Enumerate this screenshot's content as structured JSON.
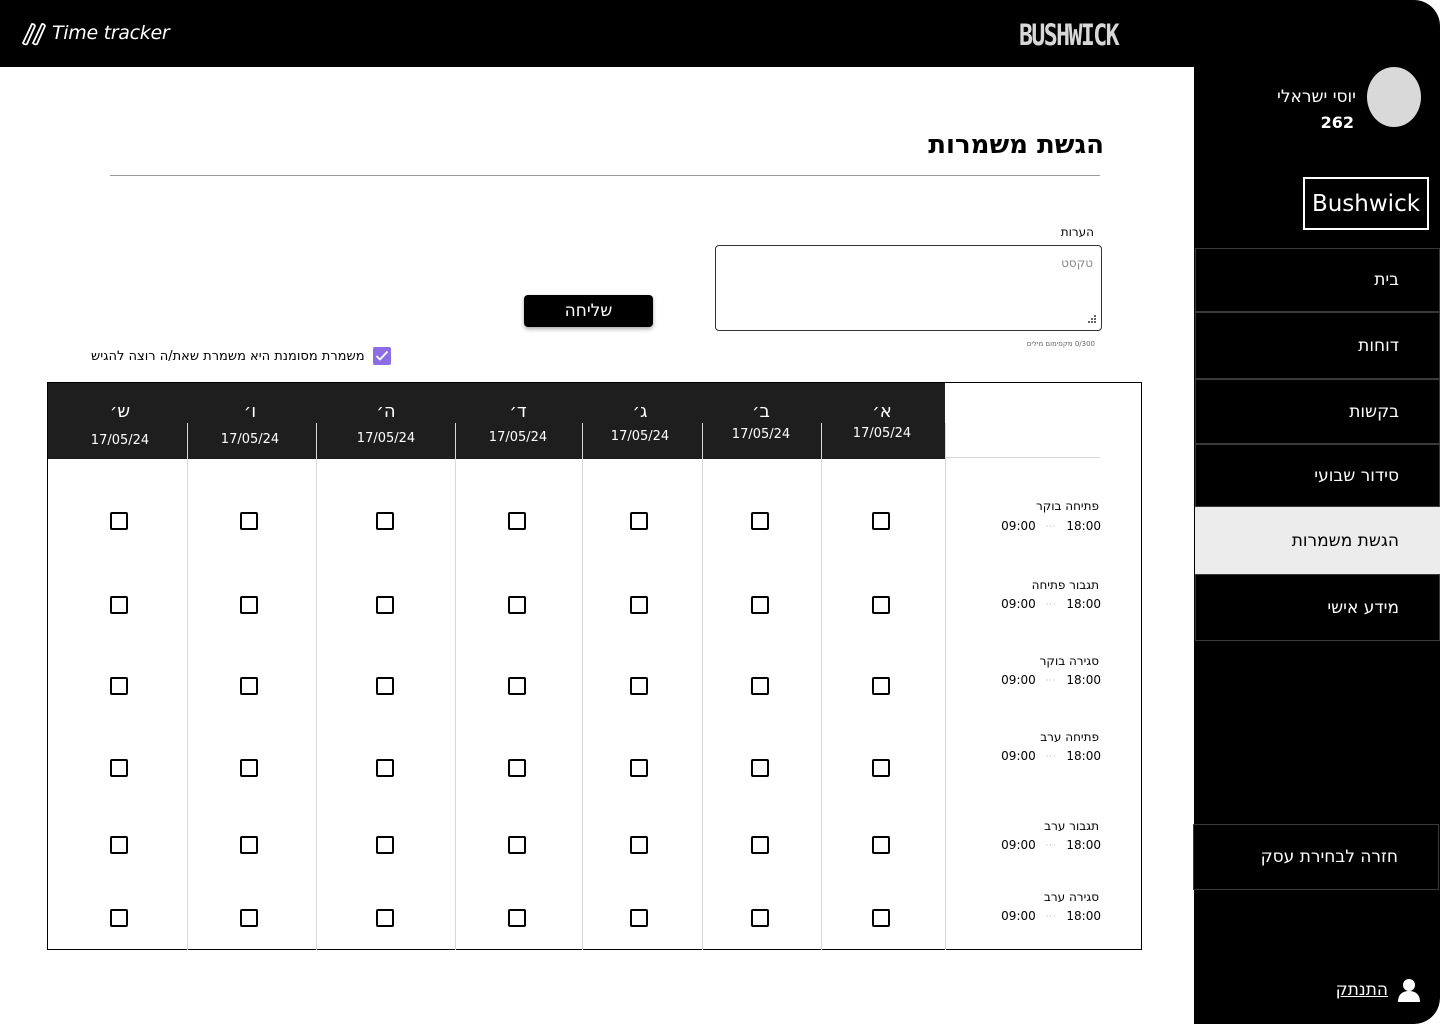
{
  "app": {
    "logo_text": "Time tracker",
    "brand": "BUSHWICK"
  },
  "user": {
    "name": "יוסי ישראלי",
    "id": "262"
  },
  "sidebar": {
    "business": "Bushwick",
    "items": [
      {
        "label": "בית",
        "active": false
      },
      {
        "label": "דוחות",
        "active": false
      },
      {
        "label": "בקשות",
        "active": false
      },
      {
        "label": "סידור שבועי",
        "active": false
      },
      {
        "label": "הגשת משמרות",
        "active": true
      },
      {
        "label": "מידע אישי",
        "active": false
      }
    ],
    "back_label": "חזרה לבחירת עסק",
    "logout_label": "התנתק"
  },
  "page": {
    "title": "הגשת משמרות",
    "notes_label": "הערות",
    "notes_placeholder": "טקסט",
    "notes_value": "",
    "char_count": "0/300 מקסימום מילים",
    "send_label": "שליחה",
    "legend_text": "משמרת מסומנת היא משמרת שאת/ה רוצה להגיש",
    "legend_checked": true
  },
  "grid": {
    "days": [
      {
        "letter": "א׳",
        "date": "17/05/24"
      },
      {
        "letter": "ב׳",
        "date": "17/05/24"
      },
      {
        "letter": "ג׳",
        "date": "17/05/24"
      },
      {
        "letter": "ד׳",
        "date": "17/05/24"
      },
      {
        "letter": "ה׳",
        "date": "17/05/24"
      },
      {
        "letter": "ו׳",
        "date": "17/05/24"
      },
      {
        "letter": "ש׳",
        "date": "17/05/24"
      }
    ],
    "shifts": [
      {
        "name": "פתיחה בוקר",
        "start": "09:00",
        "end": "18:00"
      },
      {
        "name": "תגבור פתיחה",
        "start": "09:00",
        "end": "18:00"
      },
      {
        "name": "סגירה בוקר",
        "start": "09:00",
        "end": "18:00"
      },
      {
        "name": "פתיחה ערב",
        "start": "09:00",
        "end": "18:00"
      },
      {
        "name": "תגבור ערב",
        "start": "09:00",
        "end": "18:00"
      },
      {
        "name": "סגירה ערב",
        "start": "09:00",
        "end": "18:00"
      }
    ],
    "checked": [
      [
        false,
        false,
        false,
        false,
        false,
        false,
        false
      ],
      [
        false,
        false,
        false,
        false,
        false,
        false,
        false
      ],
      [
        false,
        false,
        false,
        false,
        false,
        false,
        false
      ],
      [
        false,
        false,
        false,
        false,
        false,
        false,
        false
      ],
      [
        false,
        false,
        false,
        false,
        false,
        false,
        false
      ],
      [
        false,
        false,
        false,
        false,
        false,
        false,
        false
      ]
    ]
  },
  "colors": {
    "accent": "#8c6de6",
    "dark": "#000000",
    "active_nav": "#ececec"
  },
  "icons": [
    "logo-icon",
    "user-icon",
    "checkmark-icon",
    "resize-handle-icon"
  ]
}
